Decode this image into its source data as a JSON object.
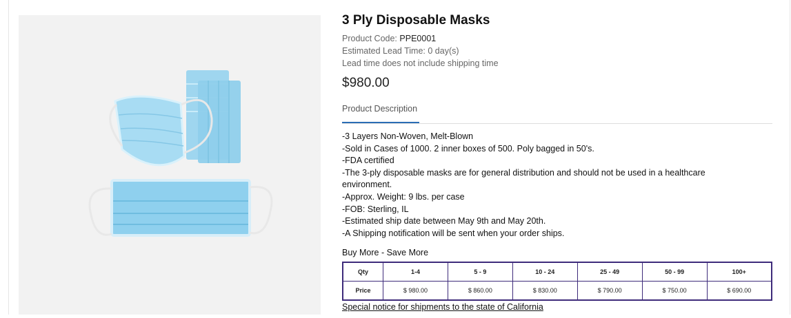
{
  "product": {
    "title": "3 Ply Disposable Masks",
    "code_label": "Product Code:",
    "code_value": "PPE0001",
    "lead_time": "Estimated Lead Time: 0 day(s)",
    "lead_note": "Lead time does not include shipping time",
    "price": "$980.00",
    "image_alt": "Blue 3-ply disposable face masks"
  },
  "tabs": {
    "description": "Product Description"
  },
  "description": [
    "-3 Layers Non-Woven, Melt-Blown",
    "-Sold in Cases of 1000. 2 inner boxes of 500. Poly bagged in 50's.",
    "-FDA certified",
    "-The 3-ply disposable masks are for general distribution and should not be used in a healthcare environment.",
    "-Approx. Weight: 9 lbs. per case",
    "-FOB: Sterling, IL",
    "-Estimated ship date between May 9th and May 20th.",
    "-A Shipping notification will be sent when your order ships."
  ],
  "buy_more": "Buy More - Save More",
  "price_table": {
    "qty_label": "Qty",
    "price_label": "Price",
    "tiers": [
      {
        "qty": "1-4",
        "price": "$ 980.00"
      },
      {
        "qty": "5 - 9",
        "price": "$ 860.00"
      },
      {
        "qty": "10 - 24",
        "price": "$ 830.00"
      },
      {
        "qty": "25 - 49",
        "price": "$ 790.00"
      },
      {
        "qty": "50 - 99",
        "price": "$ 750.00"
      },
      {
        "qty": "100+",
        "price": "$ 690.00"
      }
    ]
  },
  "notice_link": "Special notice for shipments to the state of California",
  "colors": {
    "accent": "#2a6db5",
    "table_border": "#3d2a7a",
    "mask_blue": "#8fd0ee"
  }
}
